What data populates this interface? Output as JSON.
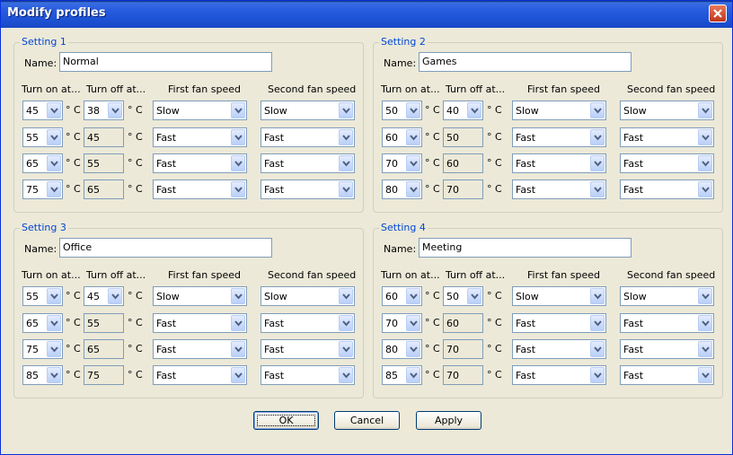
{
  "window": {
    "title": "Modify profiles"
  },
  "headers": {
    "turn_on": "Turn on at...",
    "turn_off": "Turn off at...",
    "fan1": "First fan speed",
    "fan2": "Second fan speed"
  },
  "name_label": "Name:",
  "unit": "° C",
  "settings": [
    {
      "title": "Setting 1",
      "name": "Normal",
      "rows": [
        {
          "on": "45",
          "off": "38",
          "fan1": "Slow",
          "fan2": "Slow"
        },
        {
          "on": "55",
          "off": "45",
          "fan1": "Fast",
          "fan2": "Fast"
        },
        {
          "on": "65",
          "off": "55",
          "fan1": "Fast",
          "fan2": "Fast"
        },
        {
          "on": "75",
          "off": "65",
          "fan1": "Fast",
          "fan2": "Fast"
        }
      ]
    },
    {
      "title": "Setting 2",
      "name": "Games",
      "rows": [
        {
          "on": "50",
          "off": "40",
          "fan1": "Slow",
          "fan2": "Slow"
        },
        {
          "on": "60",
          "off": "50",
          "fan1": "Fast",
          "fan2": "Fast"
        },
        {
          "on": "70",
          "off": "60",
          "fan1": "Fast",
          "fan2": "Fast"
        },
        {
          "on": "80",
          "off": "70",
          "fan1": "Fast",
          "fan2": "Fast"
        }
      ]
    },
    {
      "title": "Setting 3",
      "name": "Office",
      "rows": [
        {
          "on": "55",
          "off": "45",
          "fan1": "Slow",
          "fan2": "Slow"
        },
        {
          "on": "65",
          "off": "55",
          "fan1": "Fast",
          "fan2": "Fast"
        },
        {
          "on": "75",
          "off": "65",
          "fan1": "Fast",
          "fan2": "Fast"
        },
        {
          "on": "85",
          "off": "75",
          "fan1": "Fast",
          "fan2": "Fast"
        }
      ]
    },
    {
      "title": "Setting 4",
      "name": "Meeting",
      "rows": [
        {
          "on": "60",
          "off": "50",
          "fan1": "Slow",
          "fan2": "Slow"
        },
        {
          "on": "70",
          "off": "60",
          "fan1": "Fast",
          "fan2": "Fast"
        },
        {
          "on": "80",
          "off": "70",
          "fan1": "Fast",
          "fan2": "Fast"
        },
        {
          "on": "85",
          "off": "70",
          "fan1": "Fast",
          "fan2": "Fast"
        }
      ]
    }
  ],
  "buttons": {
    "ok": "OK",
    "cancel": "Cancel",
    "apply": "Apply"
  },
  "colors": {
    "titlebar": "#2a5ee0",
    "group_title": "#0046d5",
    "dialog_bg": "#ece9d8"
  }
}
